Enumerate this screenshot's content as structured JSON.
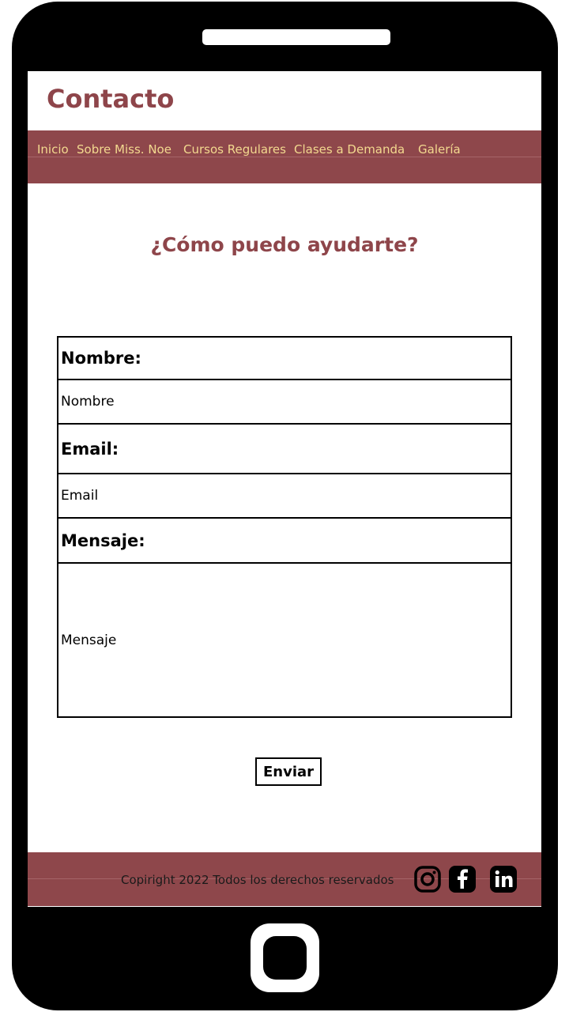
{
  "page": {
    "title": "Contacto"
  },
  "nav": {
    "items": [
      {
        "label": "Inicio"
      },
      {
        "label": "Sobre Miss. Noe"
      },
      {
        "label": "Cursos Regulares"
      },
      {
        "label": "Clases a Demanda"
      },
      {
        "label": "Galería"
      }
    ]
  },
  "main": {
    "heading": "¿Cómo puedo ayudarte?"
  },
  "form": {
    "name_label": "Nombre:",
    "name_placeholder": "Nombre",
    "email_label": "Email:",
    "email_placeholder": "Email",
    "message_label": "Mensaje:",
    "message_placeholder": "Mensaje",
    "submit_label": "Enviar"
  },
  "footer": {
    "copyright": "Copiright 2022 Todos los derechos reservados",
    "social": [
      "instagram-icon",
      "facebook-icon",
      "linkedin-icon"
    ]
  },
  "colors": {
    "brand": "#8e474b",
    "nav_text": "#f3d98f",
    "title": "#8e454a"
  }
}
